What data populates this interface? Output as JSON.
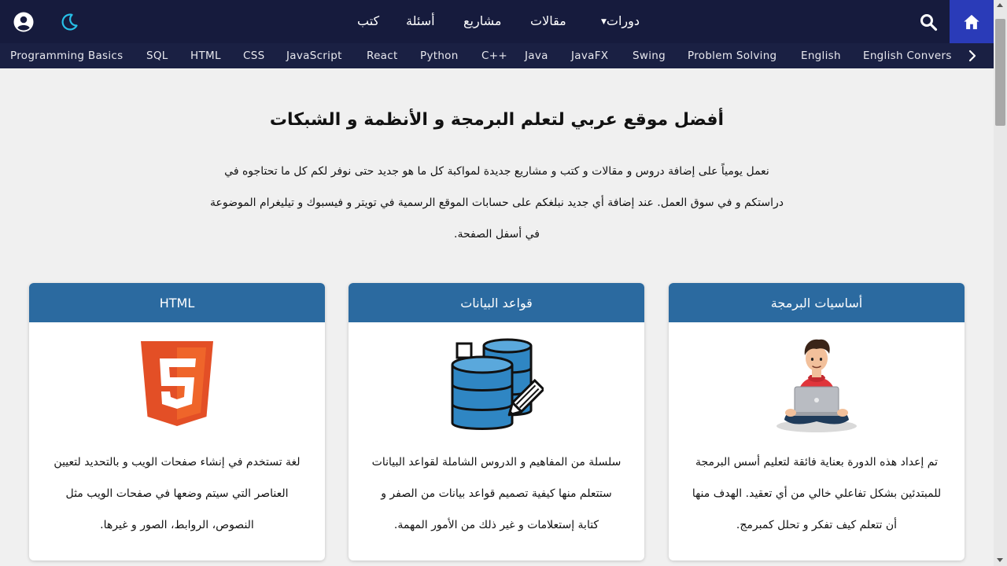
{
  "nav": {
    "items": [
      {
        "label": "دورات",
        "has_dropdown": true
      },
      {
        "label": "مقالات"
      },
      {
        "label": "مشاريع"
      },
      {
        "label": "أسئلة"
      },
      {
        "label": "كتب"
      }
    ],
    "icons": [
      "home-icon",
      "search-icon",
      "moon-icon",
      "user-icon"
    ]
  },
  "courses": [
    "Programming Basics",
    "SQL",
    "HTML",
    "CSS",
    "JavaScript",
    "React",
    "Python",
    "C++",
    "Java",
    "JavaFX",
    "Swing",
    "Problem Solving",
    "English",
    "English Convers"
  ],
  "hero": {
    "title": "أفضل موقع عربي لتعلم البرمجة و الأنظمة و الشبكات",
    "lines": [
      "نعمل يومياً على إضافة دروس و مقالات و كتب و مشاريع جديدة لمواكبة كل ما هو جديد حتى نوفر لكم كل ما تحتاجوه في",
      "دراستكم و في سوق العمل. عند إضافة أي جديد نبلغكم على حسابات الموقع الرسمية في تويتر و فيسبوك و تيليغرام الموضوعة",
      "في أسفل الصفحة."
    ]
  },
  "cards": [
    {
      "title": "أساسيات البرمجة",
      "image": "programmer-illustration",
      "lines": [
        "تم إعداد هذه الدورة بعناية فائقة لتعليم أسس البرمجة",
        "للمبتدئين بشكل تفاعلي خالي من أي تعقيد. الهدف منها",
        "أن تتعلم كيف تفكر و تحلل كمبرمج."
      ]
    },
    {
      "title": "قواعد البيانات",
      "image": "database-illustration",
      "lines": [
        "سلسلة من المفاهيم و الدروس الشاملة لقواعد البيانات",
        "ستتعلم منها كيفية تصميم قواعد بيانات من الصفر و",
        "كتابة إستعلامات و غير ذلك من الأمور المهمة."
      ]
    },
    {
      "title": "HTML",
      "image": "html5-logo",
      "lines": [
        "لغة تستخدم في إنشاء صفحات الويب و بالتحديد لتعيين",
        "العناصر التي سيتم وضعها في صفحات الويب مثل",
        "النصوص، الروابط، الصور و غيرها."
      ]
    }
  ],
  "colors": {
    "navbar": "#161b3d",
    "subbar": "#1a2043",
    "home": "#2a3bb8",
    "card_header": "#2b6aa0",
    "moon": "#27c0e8",
    "background": "#f0f0f0"
  }
}
